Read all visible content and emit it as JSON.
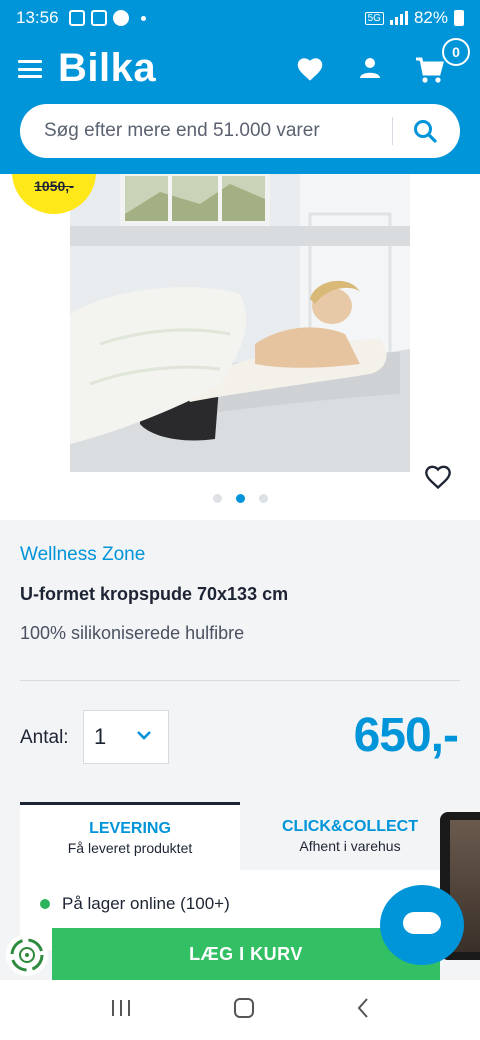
{
  "status_bar": {
    "time": "13:56",
    "network": "5G",
    "battery": "82%"
  },
  "header": {
    "logo": "Bilka",
    "cart_count": "0",
    "search_placeholder": "Søg efter mere end 51.000 varer"
  },
  "gallery": {
    "splash_price": "1050,-",
    "dot_count": 3,
    "active_dot": 2
  },
  "product": {
    "brand": "Wellness Zone",
    "title": "U-formet kropspude 70x133 cm",
    "subtitle": "100% silikoniserede hulfibre",
    "qty_label": "Antal:",
    "qty_value": "1",
    "price": "650,-"
  },
  "delivery_tabs": [
    {
      "label": "LEVERING",
      "sub": "Få leveret produktet",
      "active": true
    },
    {
      "label": "CLICK&COLLECT",
      "sub": "Afhent i varehus",
      "active": false
    }
  ],
  "stock": {
    "text": "På lager online (100+)",
    "color": "#2bb35c"
  },
  "add_to_cart": "LÆG I KURV",
  "colors": {
    "brand_blue": "#0094d9",
    "green": "#33c064",
    "splash_yellow": "#ffe81a"
  }
}
